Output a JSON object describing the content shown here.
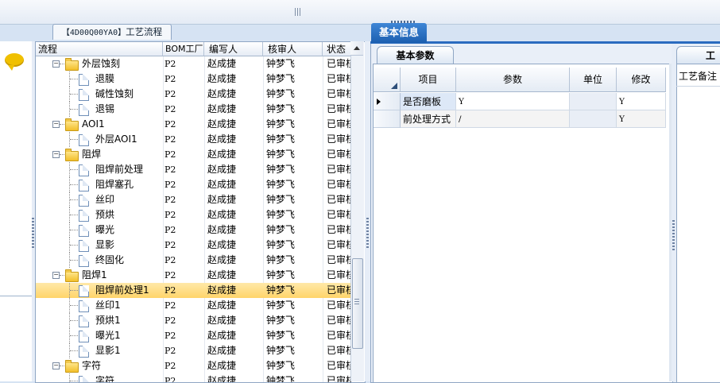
{
  "tree_tab": {
    "code": "【4D00Q00YA0】",
    "label": "工艺流程"
  },
  "tree_columns": [
    "流程",
    "BOM工厂",
    "编写人",
    "核审人",
    "状态"
  ],
  "tree_rows": [
    {
      "name": "外层蚀刻",
      "level": 0,
      "type": "folder",
      "factory": "P2",
      "writer": "赵成捷",
      "reviewer": "钟梦飞",
      "status": "已审核"
    },
    {
      "name": "退膜",
      "level": 1,
      "type": "doc",
      "factory": "P2",
      "writer": "赵成捷",
      "reviewer": "钟梦飞",
      "status": "已审核"
    },
    {
      "name": "碱性蚀刻",
      "level": 1,
      "type": "doc",
      "factory": "P2",
      "writer": "赵成捷",
      "reviewer": "钟梦飞",
      "status": "已审核"
    },
    {
      "name": "退锡",
      "level": 1,
      "type": "doc",
      "factory": "P2",
      "writer": "赵成捷",
      "reviewer": "钟梦飞",
      "status": "已审核"
    },
    {
      "name": "AOI1",
      "level": 0,
      "type": "folder",
      "factory": "P2",
      "writer": "赵成捷",
      "reviewer": "钟梦飞",
      "status": "已审核"
    },
    {
      "name": "外层AOI1",
      "level": 1,
      "type": "doc",
      "factory": "P2",
      "writer": "赵成捷",
      "reviewer": "钟梦飞",
      "status": "已审核"
    },
    {
      "name": "阻焊",
      "level": 0,
      "type": "folder",
      "factory": "P2",
      "writer": "赵成捷",
      "reviewer": "钟梦飞",
      "status": "已审核"
    },
    {
      "name": "阻焊前处理",
      "level": 1,
      "type": "doc",
      "factory": "P2",
      "writer": "赵成捷",
      "reviewer": "钟梦飞",
      "status": "已审核"
    },
    {
      "name": "阻焊塞孔",
      "level": 1,
      "type": "doc",
      "factory": "P2",
      "writer": "赵成捷",
      "reviewer": "钟梦飞",
      "status": "已审核"
    },
    {
      "name": "丝印",
      "level": 1,
      "type": "doc",
      "factory": "P2",
      "writer": "赵成捷",
      "reviewer": "钟梦飞",
      "status": "已审核"
    },
    {
      "name": "预烘",
      "level": 1,
      "type": "doc",
      "factory": "P2",
      "writer": "赵成捷",
      "reviewer": "钟梦飞",
      "status": "已审核"
    },
    {
      "name": "曝光",
      "level": 1,
      "type": "doc",
      "factory": "P2",
      "writer": "赵成捷",
      "reviewer": "钟梦飞",
      "status": "已审核"
    },
    {
      "name": "显影",
      "level": 1,
      "type": "doc",
      "factory": "P2",
      "writer": "赵成捷",
      "reviewer": "钟梦飞",
      "status": "已审核"
    },
    {
      "name": "终固化",
      "level": 1,
      "type": "doc",
      "factory": "P2",
      "writer": "赵成捷",
      "reviewer": "钟梦飞",
      "status": "已审核"
    },
    {
      "name": "阻焊1",
      "level": 0,
      "type": "folder",
      "factory": "P2",
      "writer": "赵成捷",
      "reviewer": "钟梦飞",
      "status": "已审核"
    },
    {
      "name": "阻焊前处理1",
      "level": 1,
      "type": "doc",
      "selected": true,
      "factory": "P2",
      "writer": "赵成捷",
      "reviewer": "钟梦飞",
      "status": "已审核"
    },
    {
      "name": "丝印1",
      "level": 1,
      "type": "doc",
      "factory": "P2",
      "writer": "赵成捷",
      "reviewer": "钟梦飞",
      "status": "已审核"
    },
    {
      "name": "预烘1",
      "level": 1,
      "type": "doc",
      "factory": "P2",
      "writer": "赵成捷",
      "reviewer": "钟梦飞",
      "status": "已审核"
    },
    {
      "name": "曝光1",
      "level": 1,
      "type": "doc",
      "factory": "P2",
      "writer": "赵成捷",
      "reviewer": "钟梦飞",
      "status": "已审核"
    },
    {
      "name": "显影1",
      "level": 1,
      "type": "doc",
      "factory": "P2",
      "writer": "赵成捷",
      "reviewer": "钟梦飞",
      "status": "已审核"
    },
    {
      "name": "字符",
      "level": 0,
      "type": "folder",
      "factory": "P2",
      "writer": "赵成捷",
      "reviewer": "钟梦飞",
      "status": "已审核"
    },
    {
      "name": "字符",
      "level": 1,
      "type": "doc",
      "factory": "P2",
      "writer": "赵成捷",
      "reviewer": "钟梦飞",
      "status": "已审核"
    }
  ],
  "info_tab": {
    "label": "基本信息"
  },
  "param_tab": {
    "label": "基本参数"
  },
  "param_columns": [
    "项目",
    "参数",
    "单位",
    "修改"
  ],
  "param_rows": [
    {
      "item": "是否磨板",
      "param": "Y",
      "unit": "",
      "modify": "Y"
    },
    {
      "item": "前处理方式",
      "param": "/",
      "unit": "",
      "modify": "Y"
    }
  ],
  "remark_tab": {
    "label": "工艺"
  },
  "remark": {
    "label": "工艺备注"
  },
  "icons": {
    "chat": "chat-bubble-icon",
    "folder": "folder-icon",
    "doc": "document-icon"
  },
  "colors": {
    "accent": "#1c5fb0",
    "selection": "#ffd46a",
    "folder": "#f2bf2b"
  }
}
